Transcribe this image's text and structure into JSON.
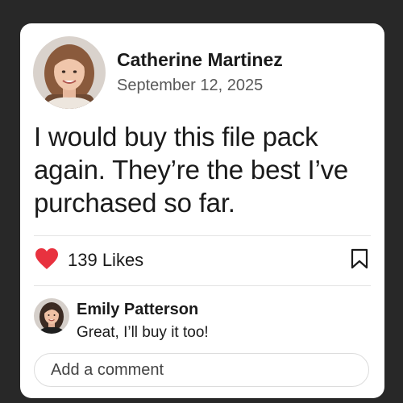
{
  "post": {
    "author_name": "Catherine Martinez",
    "date": "September 12, 2025",
    "text": "I would buy this file pack again. They’re the best I’ve purchased so far.",
    "likes_label": "139 Likes",
    "like_icon": "heart-icon",
    "like_color": "#e8323f",
    "bookmark_icon": "bookmark-icon"
  },
  "comment": {
    "author_name": "Emily Patterson",
    "text": "Great, I’ll buy it too!"
  },
  "comment_input": {
    "placeholder": "Add a comment",
    "value": ""
  }
}
